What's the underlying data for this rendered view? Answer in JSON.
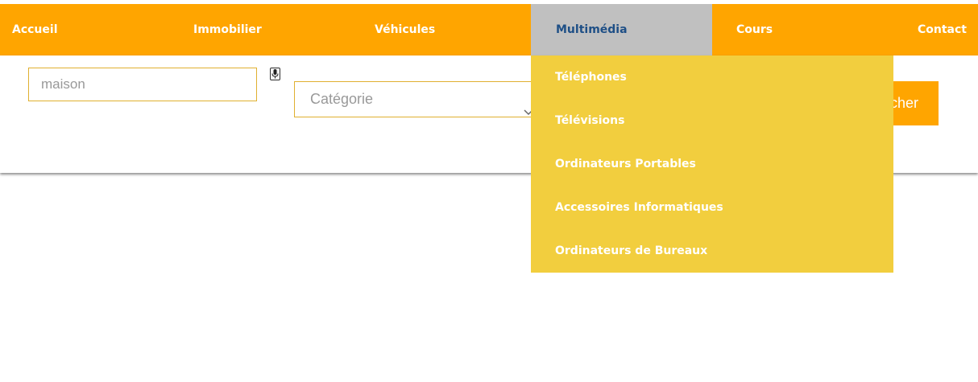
{
  "nav": {
    "items": [
      {
        "label": "Accueil"
      },
      {
        "label": "Immobilier"
      },
      {
        "label": "Véhicules"
      },
      {
        "label": "Multimédia",
        "active": true
      },
      {
        "label": "Cours"
      },
      {
        "label": "Contact"
      }
    ]
  },
  "search": {
    "value": "",
    "placeholder": "maison",
    "mic_icon": "microphone-icon"
  },
  "category": {
    "selected": "Catégorie",
    "chevron_icon": "chevron-down-icon"
  },
  "search_button": {
    "label_visible": "cher"
  },
  "dropdown": {
    "items": [
      {
        "label": "Téléphones"
      },
      {
        "label": "Télévisions"
      },
      {
        "label": "Ordinateurs Portables"
      },
      {
        "label": "Accessoires Informatiques"
      },
      {
        "label": "Ordinateurs de Bureaux"
      }
    ]
  },
  "colors": {
    "nav_bg": "#FFA500",
    "active_tab_bg": "#C0C0C0",
    "active_tab_text": "#1E4F86",
    "dropdown_bg": "#F2CE3E",
    "input_border": "#E0B030"
  }
}
